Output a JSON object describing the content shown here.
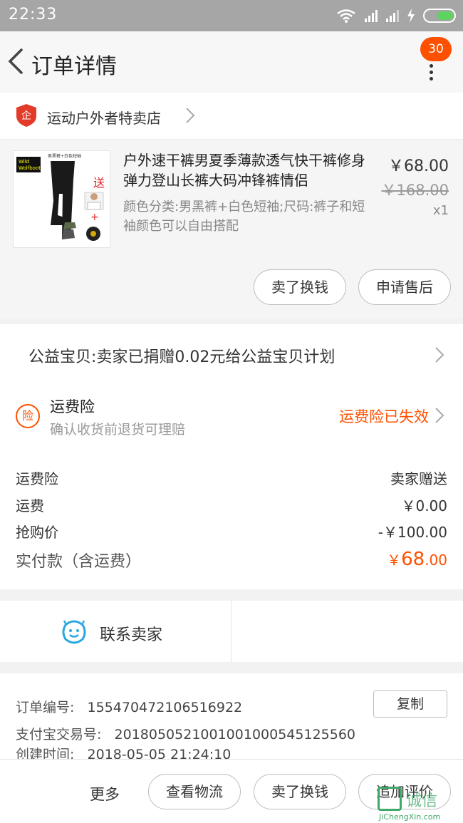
{
  "status_bar": {
    "time": "22:33"
  },
  "header": {
    "title": "订单详情",
    "badge_count": "30"
  },
  "shop": {
    "icon_label": "企",
    "name": "运动户外者特卖店"
  },
  "item": {
    "title": "户外速干裤男夏季薄款透气快干裤修身弹力登山长裤大码冲锋裤情侣",
    "spec": "颜色分类:男黑裤+白色短袖;尺码:裤子和短袖颜色可以自由搭配",
    "price": "￥68.00",
    "original_price": "￥168.00",
    "quantity": "x1",
    "thumb": {
      "brand_line1": "Wild",
      "brand_line2": "Wolfboot",
      "top_label": "男黑裤+白色短袖",
      "gift": "送"
    },
    "actions": [
      "卖了换钱",
      "申请售后"
    ]
  },
  "charity": {
    "text": "公益宝贝:卖家已捐赠0.02元给公益宝贝计划"
  },
  "insurance": {
    "icon": "险",
    "title": "运费险",
    "subtitle": "确认收货前退货可理赔",
    "status": "运费险已失效"
  },
  "fees": {
    "rows": [
      {
        "label": "运费险",
        "value": "卖家赠送"
      },
      {
        "label": "运费",
        "value": "￥0.00"
      },
      {
        "label": "抢购价",
        "value": "-￥100.00"
      }
    ],
    "total_label": "实付款（含运费）",
    "total_currency": "￥",
    "total_int": "68",
    "total_dec": ".00",
    "accent_color": "#ff5000"
  },
  "contact": {
    "label": "联系卖家"
  },
  "order_info": {
    "order_no_label": "订单编号:",
    "order_no": "1554704721065169​22",
    "copy_label": "复制",
    "alipay_label": "支付宝交易号:",
    "alipay_no": "2018050521001001000545125560",
    "created_label": "创建时间:",
    "created_time": "2018-05-05 21:24:10"
  },
  "bottom_bar": {
    "more_label": "更多",
    "buttons": [
      "查看物流",
      "卖了换钱",
      "追加评价"
    ]
  },
  "watermark": {
    "text": "诚信",
    "url": "JiChengXin.com"
  }
}
